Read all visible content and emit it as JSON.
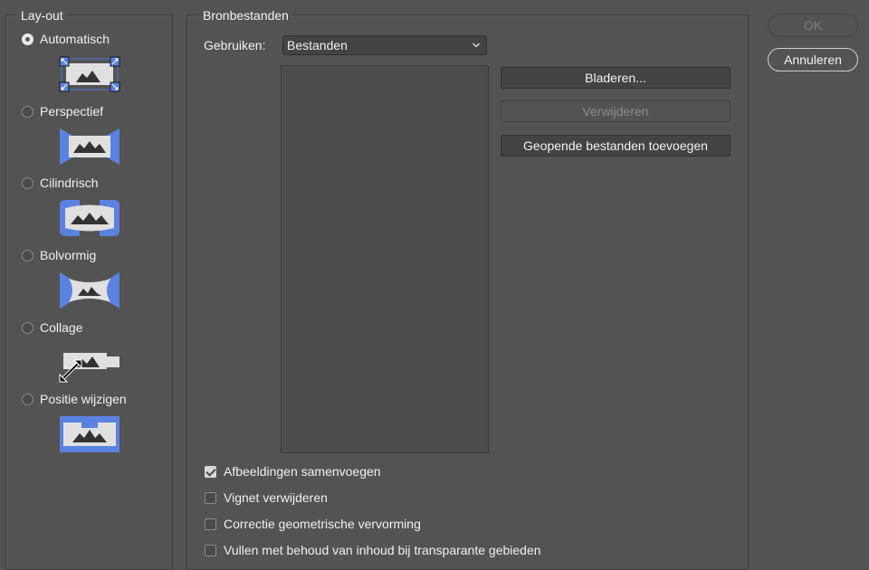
{
  "layout": {
    "title": "Lay-out",
    "options": [
      {
        "label": "Automatisch",
        "checked": true,
        "icon": "layout-auto-icon"
      },
      {
        "label": "Perspectief",
        "checked": false,
        "icon": "layout-perspective-icon"
      },
      {
        "label": "Cilindrisch",
        "checked": false,
        "icon": "layout-cylindrical-icon"
      },
      {
        "label": "Bolvormig",
        "checked": false,
        "icon": "layout-spherical-icon"
      },
      {
        "label": "Collage",
        "checked": false,
        "icon": "layout-collage-icon"
      },
      {
        "label": "Positie wijzigen",
        "checked": false,
        "icon": "layout-reposition-icon"
      }
    ]
  },
  "source": {
    "title": "Bronbestanden",
    "use_label": "Gebruiken:",
    "use_value": "Bestanden",
    "browse_button": "Bladeren...",
    "remove_button": "Verwijderen",
    "add_open_button": "Geopende bestanden toevoegen",
    "files": []
  },
  "options": {
    "blend": {
      "label": "Afbeeldingen samenvoegen",
      "checked": true
    },
    "vignette": {
      "label": "Vignet verwijderen",
      "checked": false
    },
    "distortion": {
      "label": "Correctie geometrische vervorming",
      "checked": false
    },
    "content_aware": {
      "label": "Vullen met behoud van inhoud bij transparante gebieden",
      "checked": false
    }
  },
  "buttons": {
    "ok": "OK",
    "cancel": "Annuleren"
  },
  "colors": {
    "background": "#535353",
    "accent_blue": "#5b82e0",
    "thumb_gray": "#e0e0e0"
  }
}
